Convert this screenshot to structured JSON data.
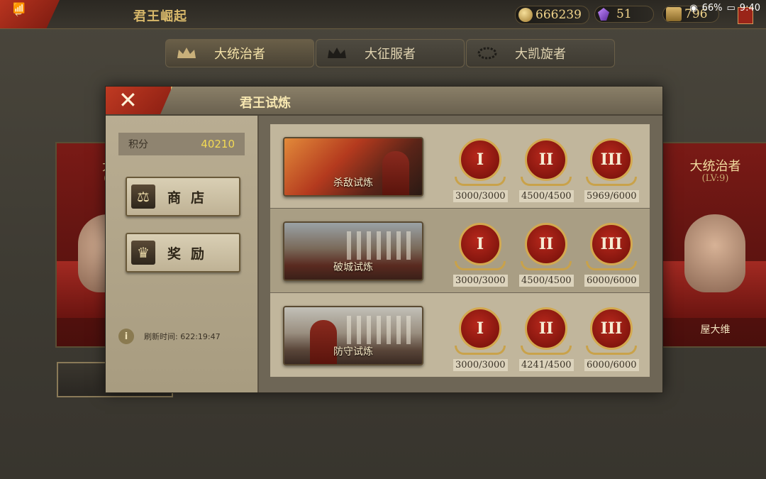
{
  "topbar": {
    "title": "君王崛起",
    "coins": "666239",
    "gems": "51",
    "laurels": "796",
    "battery": "66%",
    "time": "9:40"
  },
  "tabs": [
    {
      "label": "大统治者",
      "active": true,
      "icon": "crown-icon"
    },
    {
      "label": "大征服者",
      "active": false,
      "icon": "crown-icon"
    },
    {
      "label": "大凯旋者",
      "active": false,
      "icon": "laurel-wreath-icon"
    }
  ],
  "side_right": {
    "title": "大统治者",
    "level": "(LV:9)",
    "name": "屋大维"
  },
  "side_left": {
    "title": "大",
    "level": "(L"
  },
  "modal": {
    "title": "君王试炼",
    "score_label": "积分",
    "score_value": "40210",
    "shop_label": "商店",
    "reward_label": "奖励",
    "refresh_text": "刷新时间: 622:19:47"
  },
  "trials": [
    {
      "name": "杀敌试炼",
      "medals": [
        {
          "numeral": "I",
          "progress": "3000/3000"
        },
        {
          "numeral": "II",
          "progress": "4500/4500"
        },
        {
          "numeral": "III",
          "progress": "5969/6000"
        }
      ]
    },
    {
      "name": "破城试炼",
      "medals": [
        {
          "numeral": "I",
          "progress": "3000/3000"
        },
        {
          "numeral": "II",
          "progress": "4500/4500"
        },
        {
          "numeral": "III",
          "progress": "6000/6000"
        }
      ]
    },
    {
      "name": "防守试炼",
      "medals": [
        {
          "numeral": "I",
          "progress": "3000/3000"
        },
        {
          "numeral": "II",
          "progress": "4241/4500"
        },
        {
          "numeral": "III",
          "progress": "6000/6000"
        }
      ]
    }
  ],
  "colors": {
    "accent_red": "#b8281c",
    "gold": "#d3a950",
    "score_yellow": "#f3da54"
  }
}
